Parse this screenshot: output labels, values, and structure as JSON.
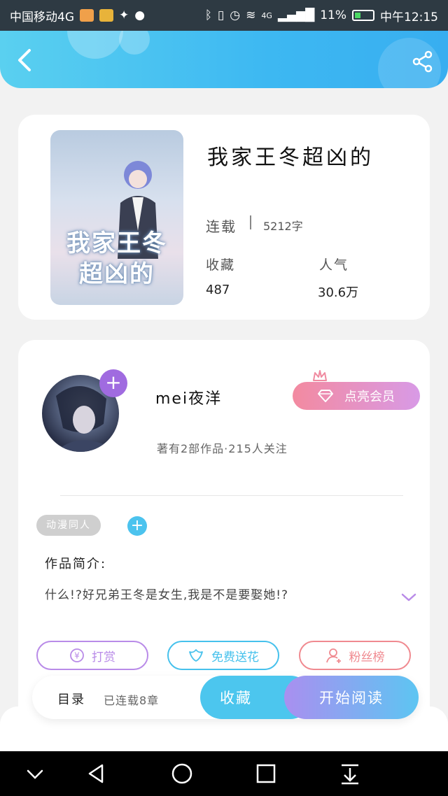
{
  "status_bar": {
    "carrier": "中国移动4G",
    "network": "4G",
    "battery": "11%",
    "time": "中午12:15",
    "colors": {
      "app1": "#f0a04a",
      "app2": "#e8b33a"
    }
  },
  "header": {
    "back_icon": "chevron-left-icon",
    "share_icon": "share-icon"
  },
  "book": {
    "cover_text": "我家王冬超凶的",
    "title": "我家王冬超凶的",
    "status": "连载",
    "word_count": "5212字",
    "favorites_label": "收藏",
    "favorites_value": "487",
    "popularity_label": "人气",
    "popularity_value": "30.6万"
  },
  "author": {
    "name": "mei夜洋",
    "follow_icon": "plus-icon",
    "meta": "著有2部作品·215人关注",
    "vip_button": "点亮会员"
  },
  "work": {
    "tag": "动漫同人",
    "intro_label": "作品简介:",
    "intro_text": "什么!?好兄弟王冬是女生,我是不是要娶她!?"
  },
  "actions": [
    {
      "label": "打赏",
      "icon": "yen-icon",
      "color": "#b98be8"
    },
    {
      "label": "免费送花",
      "icon": "flower-icon",
      "color": "#46c1ec"
    },
    {
      "label": "粉丝榜",
      "icon": "user-icon",
      "color": "#f08a90"
    }
  ],
  "bottom": {
    "toc_label": "目录",
    "chapter_count": "已连载8章",
    "collect_button": "收藏",
    "read_button": "开始阅读"
  },
  "colors": {
    "accent_blue": "#3db8f2",
    "accent_purple": "#a06be0"
  }
}
